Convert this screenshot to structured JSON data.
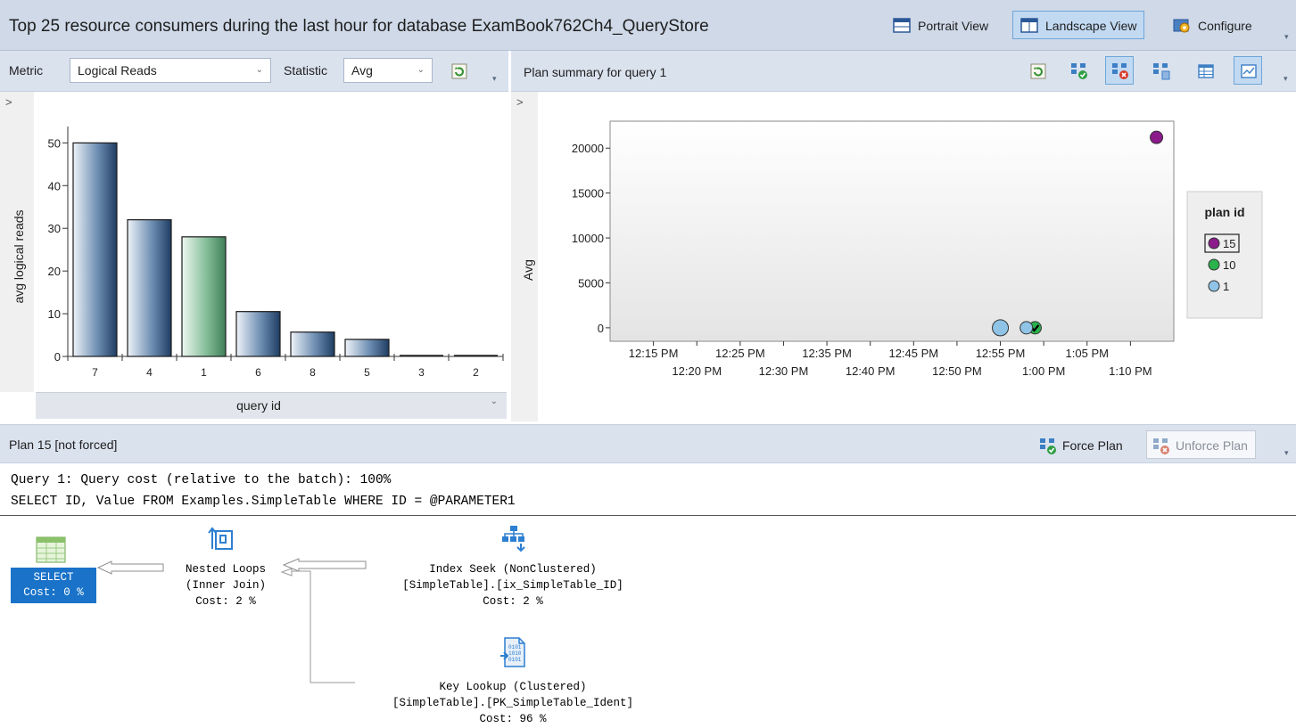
{
  "titlebar": {
    "title": "Top 25 resource consumers during the last hour for database ExamBook762Ch4_QueryStore",
    "portrait_label": "Portrait View",
    "landscape_label": "Landscape View",
    "configure_label": "Configure"
  },
  "left_pane": {
    "metric_label": "Metric",
    "metric_value": "Logical Reads",
    "statistic_label": "Statistic",
    "statistic_value": "Avg",
    "xaxis_label": "query id",
    "expander": ">"
  },
  "right_pane": {
    "header": "Plan summary for query 1",
    "expander": ">"
  },
  "plan_bar": {
    "title": "Plan 15 [not forced]",
    "force_label": "Force Plan",
    "unforce_label": "Unforce Plan"
  },
  "showplan": {
    "query_cost_line": "Query 1: Query cost (relative to the batch): 100%",
    "sql_line": "SELECT ID, Value FROM Examples.SimpleTable WHERE ID = @PARAMETER1",
    "select_node": {
      "line1": "SELECT",
      "line2": "Cost: 0 %"
    },
    "nested_loops": {
      "line1": "Nested Loops",
      "line2": "(Inner Join)",
      "line3": "Cost: 2 %"
    },
    "index_seek": {
      "line1": "Index Seek (NonClustered)",
      "line2": "[SimpleTable].[ix_SimpleTable_ID]",
      "line3": "Cost: 2 %"
    },
    "key_lookup": {
      "line1": "Key Lookup (Clustered)",
      "line2": "[SimpleTable].[PK_SimpleTable_Ident]",
      "line3": "Cost: 96 %"
    }
  },
  "colors": {
    "bar_blue": "#3b5a82",
    "bar_green": "#5f9e78",
    "plan15": "#8b1a8b",
    "plan10": "#2bb24c",
    "plan1": "#8fc4e6",
    "selected_node": "#1a73c9"
  },
  "chart_data": [
    {
      "type": "bar",
      "ylabel": "avg logical reads",
      "xlabel": "query id",
      "categories": [
        "7",
        "4",
        "1",
        "6",
        "8",
        "5",
        "3",
        "2"
      ],
      "values": [
        50,
        32,
        28,
        10.5,
        5.7,
        4,
        0,
        0
      ],
      "highlighted_category": "1",
      "ylim": [
        0,
        53
      ],
      "yticks": [
        0,
        10,
        20,
        30,
        40,
        50
      ]
    },
    {
      "type": "scatter",
      "ylabel": "Avg",
      "ylim": [
        -1500,
        23000
      ],
      "yticks": [
        0,
        5000,
        10000,
        15000,
        20000
      ],
      "xticks_top": [
        "12:15 PM",
        "12:25 PM",
        "12:35 PM",
        "12:45 PM",
        "12:55 PM",
        "1:05 PM"
      ],
      "xticks_bottom": [
        "12:20 PM",
        "12:30 PM",
        "12:40 PM",
        "12:50 PM",
        "1:00 PM",
        "1:10 PM"
      ],
      "legend_title": "plan id",
      "legend_position": "right",
      "series": [
        {
          "name": "15",
          "color": "#8b1a8b",
          "points": [
            {
              "x": "1:13 PM",
              "y": 21200
            }
          ]
        },
        {
          "name": "10",
          "color": "#2bb24c",
          "points": [
            {
              "x": "12:59 PM",
              "y": 0
            }
          ]
        },
        {
          "name": "1",
          "color": "#8fc4e6",
          "points": [
            {
              "x": "12:55 PM",
              "y": 0
            },
            {
              "x": "12:58 PM",
              "y": 0
            }
          ]
        }
      ]
    }
  ]
}
